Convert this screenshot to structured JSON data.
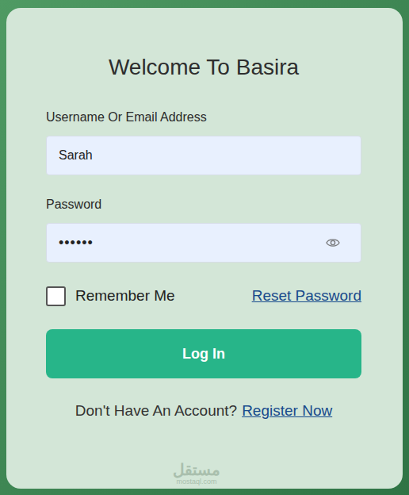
{
  "title": "Welcome To Basira",
  "username": {
    "label": "Username Or Email Address",
    "value": "Sarah"
  },
  "password": {
    "label": "Password",
    "value": "••••••",
    "visible": false
  },
  "remember": {
    "label": "Remember Me",
    "checked": false
  },
  "reset_link": "Reset Password",
  "login_button": "Log In",
  "register": {
    "prompt": "Don't Have An Account?",
    "link": "Register Now"
  },
  "watermark": {
    "text": "مستقل",
    "sub": "mostaql.com"
  }
}
